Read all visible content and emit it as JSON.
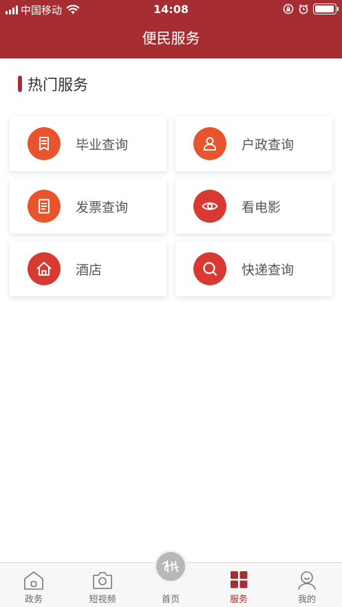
{
  "status_bar": {
    "carrier": "中国移动",
    "time": "14:08",
    "battery_level": 0.95
  },
  "header": {
    "title": "便民服务"
  },
  "section": {
    "title": "热门服务"
  },
  "services": [
    {
      "label": "毕业查询",
      "icon": "document-icon",
      "color": "#e8552d"
    },
    {
      "label": "户政查询",
      "icon": "person-icon",
      "color": "#e8552d"
    },
    {
      "label": "发票查询",
      "icon": "receipt-icon",
      "color": "#e8552d"
    },
    {
      "label": "看电影",
      "icon": "eye-icon",
      "color": "#d83a32"
    },
    {
      "label": "酒店",
      "icon": "house-icon",
      "color": "#d83a32"
    },
    {
      "label": "快递查询",
      "icon": "search-icon",
      "color": "#d83a32"
    }
  ],
  "tabbar": {
    "items": [
      {
        "label": "政务",
        "icon": "building-icon"
      },
      {
        "label": "短视频",
        "icon": "camera-icon"
      },
      {
        "label": "首页",
        "icon": "home-logo-icon"
      },
      {
        "label": "服务",
        "icon": "grid-icon",
        "active": true
      },
      {
        "label": "我的",
        "icon": "user-icon"
      }
    ],
    "active_color": "#a62d31"
  },
  "colors": {
    "brand": "#a62d31",
    "orange": "#e8552d",
    "red": "#d83a32"
  }
}
